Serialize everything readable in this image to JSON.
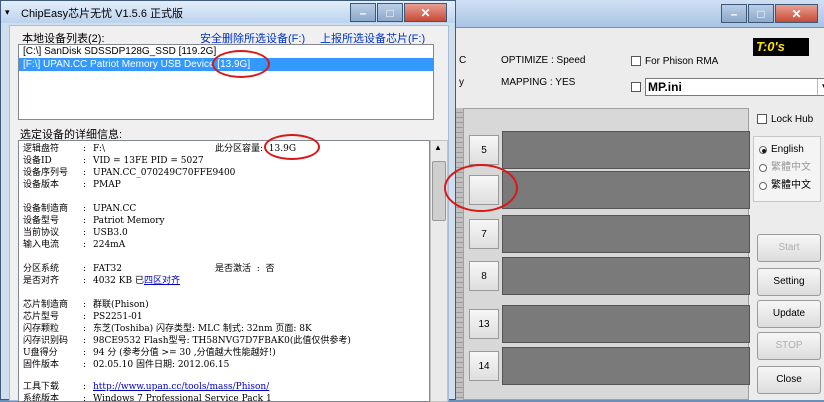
{
  "bg": {
    "options": [
      "C",
      "y"
    ],
    "optimize": "OPTIMIZE : Speed",
    "mapping": "MAPPING : YES",
    "phison_rma": "For Phison RMA",
    "mp_ini": "MP.ini",
    "t0s": "T:0's",
    "lock_hub": "Lock Hub",
    "lang": {
      "english": "English",
      "trad1": "繁體中文",
      "trad2": "繁體中文"
    },
    "buttons": {
      "start": "Start",
      "setting": "Setting",
      "update": "Update",
      "stop": "STOP",
      "close": "Close"
    },
    "slots": [
      "5",
      "",
      "7",
      "8",
      "13",
      "14"
    ],
    "accent_bar_color": "#7a7a7a"
  },
  "dialog": {
    "title": "ChipEasy芯片无忧 V1.5.6 正式版",
    "devlist_label": "本地设备列表(2):",
    "safe_remove": "安全删除所选设备(F:)",
    "report": "上报所选设备芯片(F:)",
    "devices": [
      "[C:\\] SanDisk SDSSDP128G_SSD [119.2G]",
      "[F:\\] UPAN.CC Patriot Memory USB Device [13.9G]"
    ],
    "detail_label": "选定设备的详细信息:",
    "details": {
      "logical_k": "逻辑盘符",
      "logical_v": "F:\\",
      "partcap_k": "此分区容量:",
      "partcap_v": "13.9G",
      "devid_k": "设备ID",
      "devid_v": "VID = 13FE     PID = 5027",
      "serial_k": "设备序列号",
      "serial_v": "UPAN.CC_070249C70FFE9400",
      "ver_k": "设备版本",
      "ver_v": "PMAP",
      "maker_k": "设备制造商",
      "maker_v": "UPAN.CC",
      "model_k": "设备型号",
      "model_v": "Patriot Memory",
      "proto_k": "当前协议",
      "proto_v": "USB3.0",
      "cur_k": "输入电流",
      "cur_v": "224mA",
      "fs_k": "分区系统",
      "fs_v": "FAT32",
      "active_k": "是否激活",
      "active_v": "否",
      "align_k": "是否对齐",
      "align_v": "4032 KB 已",
      "align_link": "四区对齐",
      "chipmaker_k": "芯片制造商",
      "chipmaker_v": "群联(Phison)",
      "chipmodel_k": "芯片型号",
      "chipmodel_v": "PS2251-01",
      "flash_k": "闪存颗粒",
      "flash_v": "东芝(Toshiba)  闪存类型: MLC  制式: 32nm  页面: 8K",
      "flashid_k": "闪存识别码",
      "flashid_v": "98CE9532         Flash型号: TH58NVG7D7FBAK0(此值仅供参考)",
      "score_k": "U盘得分",
      "score_v": "94 分          (参考分值 >= 30 ,分值越大性能越好!)",
      "fw_k": "固件版本",
      "fw_v": "02.05.10      固件日期:  2012.06.15",
      "tool_k": "工具下载",
      "tool_v": "http://www.upan.cc/tools/mass/Phison/",
      "os_k": "系统版本",
      "os_v": "Windows 7 Professional Service Pack 1"
    }
  }
}
